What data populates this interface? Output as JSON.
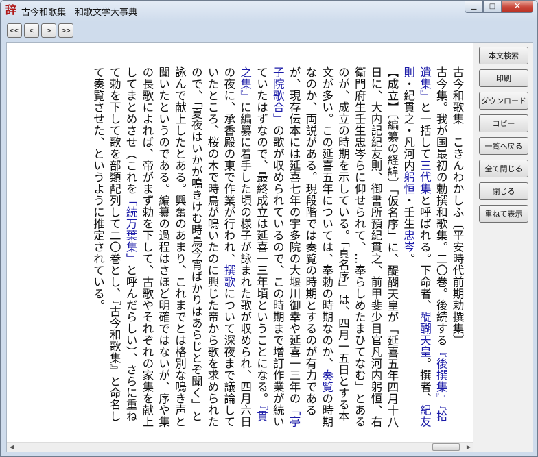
{
  "window": {
    "title": "古今和歌集　和歌文学大事典",
    "icon_char": "辞",
    "controls": {
      "minimize": "▁",
      "maximize": "□",
      "close": "✕"
    }
  },
  "nav": {
    "first": "<<",
    "prev": "<",
    "next": ">",
    "last": ">>"
  },
  "content": {
    "segments": [
      {
        "text": "古今和歌集　こきんわかしふ〔平安時代前期勅撰集〕",
        "link": false
      },
      {
        "text": "古今集。我が国最初の勅撰和歌集。二〇巻。後続する",
        "link": false
      },
      {
        "text": "『後撰集』『拾遺集』",
        "link": true
      },
      {
        "text": "と一括して",
        "link": false
      },
      {
        "text": "三代集",
        "link": true
      },
      {
        "text": "と呼ばれる。下命者、",
        "link": false
      },
      {
        "text": "醍醐天皇",
        "link": true
      },
      {
        "text": "。撰者、",
        "link": false
      },
      {
        "text": "紀友則",
        "link": true
      },
      {
        "text": "・紀貫之・凡河内",
        "link": false
      },
      {
        "text": "躬恒",
        "link": true
      },
      {
        "text": "・壬生",
        "link": false
      },
      {
        "text": "忠岑",
        "link": true
      },
      {
        "text": "。",
        "link": false
      },
      {
        "text": "【成立】〔編纂の経緯〕「仮名序」に、醍醐天皇が「延喜五年四月十八日に、大内記紀友則、御書所預紀貫之、前甲斐少目官凡河内躬恒、右衛門府生壬生忠岑らに仰せられて、…奉らしめたまひてなむ」とあるのが、成立の時期を示している。「真名序」は、四月一五日とする本文が多い。この延喜五年については、奉勅の時期なのか、",
        "link": false
      },
      {
        "text": "奏覧",
        "link": true
      },
      {
        "text": "の時期なのか、両説がある。現段階では奏覧の時期とするのが有力であるが、現存伝本には延喜七年の宇多院の大堰川御幸や延喜一三年の",
        "link": false
      },
      {
        "text": "「亭子院歌合」",
        "link": true
      },
      {
        "text": "の歌が収められているので、この時期まで増訂作業が続いていたはずなので、最終成立は延喜一三年頃ということになる。",
        "link": false
      },
      {
        "text": "『貫之集』",
        "link": true
      },
      {
        "text": "に編纂に着手した頃の様子が詠まれた歌が収められ、四月六日の夜に、承香殿の東で作業が行われ、",
        "link": false
      },
      {
        "text": "撰歌",
        "link": true
      },
      {
        "text": "について深夜まで議論していたところ、桜の木で時鳥が鳴いたのに興じた帝から歌を求められたので、「夏夜はいかが鳴きけむ時鳥今宵ばかりはあらじとぞ聞く」と詠んで献上したとある。興奮のあまり、これまでとは格別な鳴き声と聞いたというのである。編纂の過程はさほど明確ではないが、序や集の長歌によれば、帝がまず勅を下して、古歌やそれぞれの家集を献上してまとめさせ（これを",
        "link": false
      },
      {
        "text": "「続万葉集」",
        "link": true
      },
      {
        "text": "と呼んだらしい）、さらに重ねて勅を下して歌を部類配列して二〇巻とし、『古今和歌集』と命名して奏覧させた、というように推定されている。",
        "link": false
      }
    ]
  },
  "sidebar": {
    "buttons": [
      "本文検索",
      "印刷",
      "ダウンロード",
      "コピー",
      "一覧へ戻る",
      "全て閉じる",
      "閉じる",
      "重ねて表示"
    ]
  },
  "hscroll": {
    "left_arrow": "◀",
    "right_arrow": "▶",
    "grip": "|||"
  }
}
